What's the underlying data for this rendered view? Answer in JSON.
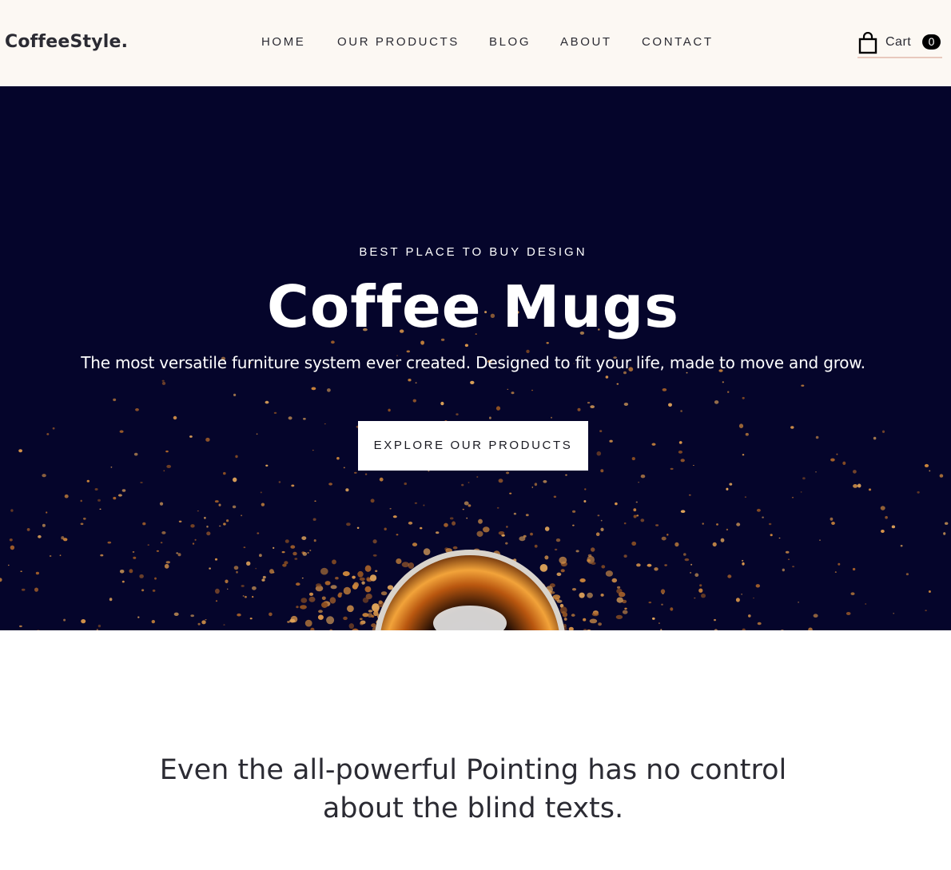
{
  "brand": {
    "logo_text": "CoffeeStyle."
  },
  "nav": {
    "items": [
      {
        "label": "HOME"
      },
      {
        "label": "OUR PRODUCTS"
      },
      {
        "label": "BLOG"
      },
      {
        "label": "ABOUT"
      },
      {
        "label": "CONTACT"
      }
    ]
  },
  "cart": {
    "label": "Cart",
    "count": "0",
    "icon": "shopping-bag-icon"
  },
  "hero": {
    "eyebrow": "BEST PLACE TO BUY DESIGN",
    "title": "Coffee Mugs",
    "subtitle": "The most versatile furniture system ever created. Designed to fit your life, made to move and grow.",
    "cta_label": "EXPLORE OUR PRODUCTS"
  },
  "intro": {
    "line1": "Even the all-powerful Pointing has no control",
    "line2": "about the blind texts."
  },
  "colors": {
    "header_bg": "#fcf8f3",
    "hero_bg": "#05052b",
    "text_dark": "#2b2b33",
    "accent_underline": "#e8c9bd",
    "coffee": "#c47a35"
  }
}
